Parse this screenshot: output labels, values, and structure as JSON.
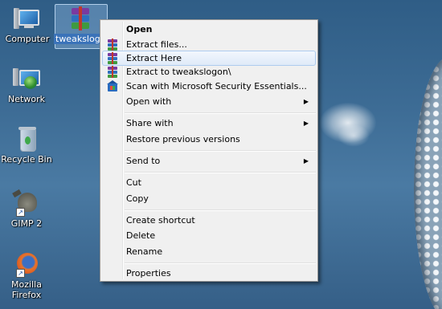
{
  "desktop": {
    "icons": [
      {
        "label": "Computer",
        "icon": "computer-icon"
      },
      {
        "label": "tweakslogon",
        "icon": "winrar-archive-icon"
      },
      {
        "label": "Network",
        "icon": "network-icon"
      },
      {
        "label": "Recycle Bin",
        "icon": "recycle-bin-icon"
      },
      {
        "label": "GIMP 2",
        "icon": "gimp-icon"
      },
      {
        "label": "Mozilla Firefox",
        "icon": "firefox-icon"
      }
    ]
  },
  "menu": {
    "items": [
      {
        "label": "Open",
        "bold": true
      },
      {
        "label": "Extract files...",
        "icon": "winrar-icon"
      },
      {
        "label": "Extract Here",
        "icon": "winrar-icon",
        "highlighted": true
      },
      {
        "label": "Extract to tweakslogon\\",
        "icon": "winrar-icon"
      },
      {
        "label": "Scan with Microsoft Security Essentials...",
        "icon": "security-essentials-icon"
      },
      {
        "label": "Open with",
        "submenu": true
      },
      {
        "label": "Share with",
        "submenu": true
      },
      {
        "label": "Restore previous versions"
      },
      {
        "label": "Send to",
        "submenu": true
      },
      {
        "label": "Cut"
      },
      {
        "label": "Copy"
      },
      {
        "label": "Create shortcut"
      },
      {
        "label": "Delete"
      },
      {
        "label": "Rename"
      },
      {
        "label": "Properties"
      }
    ],
    "submenu_arrow": "▶"
  },
  "colors": {
    "menu_bg": "#f0f0f0",
    "highlight_border": "#aeccef",
    "desktop_bg": "#3d6c95"
  }
}
